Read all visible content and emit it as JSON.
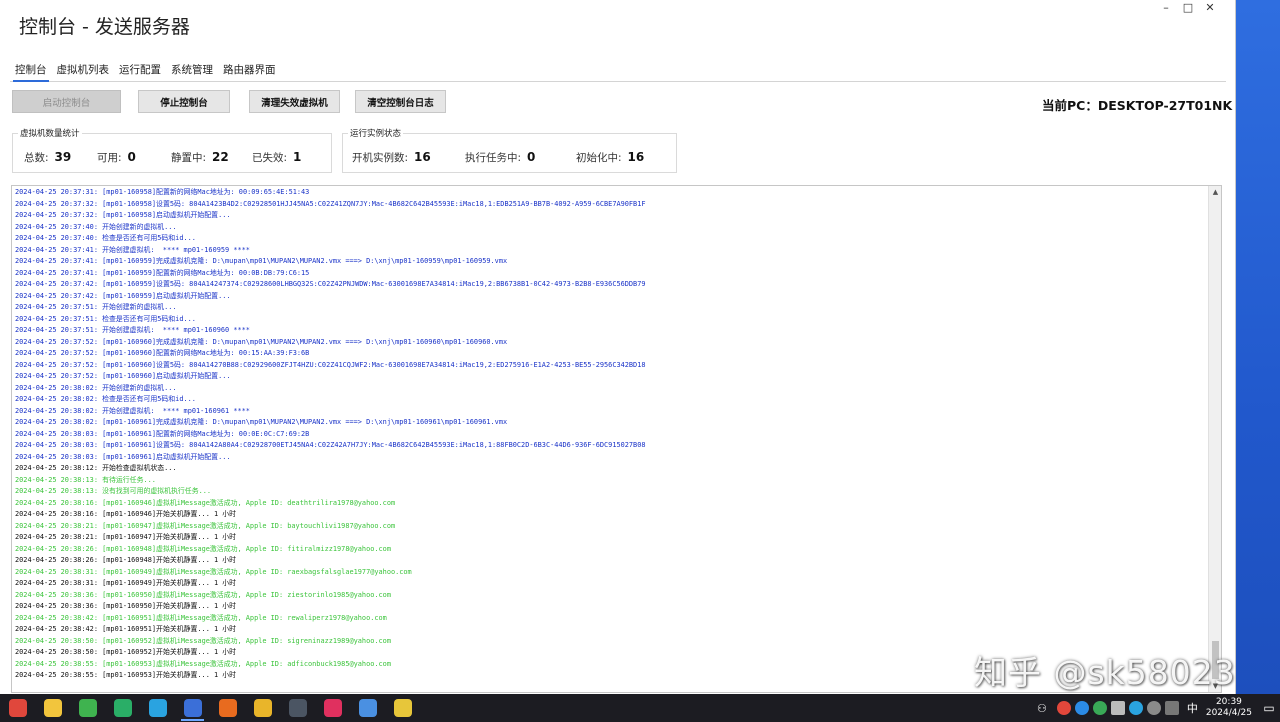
{
  "window": {
    "title": "控制台 - 发送服务器",
    "controls": [
      "–",
      "□",
      "✕"
    ]
  },
  "tabs": [
    "控制台",
    "虚拟机列表",
    "运行配置",
    "系统管理",
    "路由器界面"
  ],
  "buttons": {
    "start": "启动控制台",
    "stop": "停止控制台",
    "clean": "清理失效虚拟机",
    "clear_log": "清空控制台日志"
  },
  "pc": {
    "label": "当前PC：",
    "name": "DESKTOP-27T01NK"
  },
  "vm_stats": {
    "title": "虚拟机数量统计",
    "total_label": "总数:",
    "total": "39",
    "available_label": "可用:",
    "available": "0",
    "idle_label": "静置中:",
    "idle": "22",
    "invalid_label": "已失效:",
    "invalid": "1"
  },
  "run_stats": {
    "title": "运行实例状态",
    "running_label": "开机实例数:",
    "running": "16",
    "tasks_label": "执行任务中:",
    "tasks": "0",
    "init_label": "初始化中:",
    "init": "16"
  },
  "log": [
    {
      "c": "blue",
      "t": "2024-04-25 20:37:31: [mp01-160958]配置新的网络Mac地址为: 00:09:65:4E:51:43"
    },
    {
      "c": "blue",
      "t": "2024-04-25 20:37:32: [mp01-160958]设置5码: 804A1423B4D2:C02928501HJJ45NA5:C02Z41ZQN7JY:Mac-4B682C642B45593E:iMac18,1:EDB251A9-BB7B-4092-A959-6CBE7A90FB1F"
    },
    {
      "c": "blue",
      "t": "2024-04-25 20:37:32: [mp01-160958]启动虚拟机开始配置..."
    },
    {
      "c": "blue",
      "t": "2024-04-25 20:37:40: 开始创建新的虚拟机..."
    },
    {
      "c": "blue",
      "t": "2024-04-25 20:37:40: 检查是否还有可用5码和id..."
    },
    {
      "c": "blue",
      "t": "2024-04-25 20:37:41: 开始创建虚拟机:  **** mp01-160959 ****"
    },
    {
      "c": "blue",
      "t": "2024-04-25 20:37:41: [mp01-160959]完成虚拟机克隆: D:\\mupan\\mp01\\MUPAN2\\MUPAN2.vmx ===> D:\\xnj\\mp01-160959\\mp01-160959.vmx"
    },
    {
      "c": "blue",
      "t": "2024-04-25 20:37:41: [mp01-160959]配置新的网络Mac地址为: 00:0B:DB:79:C6:15"
    },
    {
      "c": "blue",
      "t": "2024-04-25 20:37:42: [mp01-160959]设置5码: 804A14247374:C02928600LHBGQ32S:C02Z42PNJWDW:Mac-63001698E7A34814:iMac19,2:BB6738B1-0C42-4973-B2B8-E936C56DDB79"
    },
    {
      "c": "blue",
      "t": "2024-04-25 20:37:42: [mp01-160959]启动虚拟机开始配置..."
    },
    {
      "c": "blue",
      "t": "2024-04-25 20:37:51: 开始创建新的虚拟机..."
    },
    {
      "c": "blue",
      "t": "2024-04-25 20:37:51: 检查是否还有可用5码和id..."
    },
    {
      "c": "blue",
      "t": "2024-04-25 20:37:51: 开始创建虚拟机:  **** mp01-160960 ****"
    },
    {
      "c": "blue",
      "t": "2024-04-25 20:37:52: [mp01-160960]完成虚拟机克隆: D:\\mupan\\mp01\\MUPAN2\\MUPAN2.vmx ===> D:\\xnj\\mp01-160960\\mp01-160960.vmx"
    },
    {
      "c": "blue",
      "t": "2024-04-25 20:37:52: [mp01-160960]配置新的网络Mac地址为: 00:15:AA:39:F3:6B"
    },
    {
      "c": "blue",
      "t": "2024-04-25 20:37:52: [mp01-160960]设置5码: 804A14270B88:C02929600ZFJT4HZU:C02Z41CQJWF2:Mac-63001698E7A34814:iMac19,2:ED275916-E1A2-4253-BE55-2956C342BD18"
    },
    {
      "c": "blue",
      "t": "2024-04-25 20:37:52: [mp01-160960]启动虚拟机开始配置..."
    },
    {
      "c": "blue",
      "t": "2024-04-25 20:38:02: 开始创建新的虚拟机..."
    },
    {
      "c": "blue",
      "t": "2024-04-25 20:38:02: 检查是否还有可用5码和id..."
    },
    {
      "c": "blue",
      "t": "2024-04-25 20:38:02: 开始创建虚拟机:  **** mp01-160961 ****"
    },
    {
      "c": "blue",
      "t": "2024-04-25 20:38:02: [mp01-160961]完成虚拟机克隆: D:\\mupan\\mp01\\MUPAN2\\MUPAN2.vmx ===> D:\\xnj\\mp01-160961\\mp01-160961.vmx"
    },
    {
      "c": "blue",
      "t": "2024-04-25 20:38:03: [mp01-160961]配置新的网络Mac地址为: 00:0E:0C:C7:69:2B"
    },
    {
      "c": "blue",
      "t": "2024-04-25 20:38:03: [mp01-160961]设置5码: 804A142A80A4:C02928700ETJ45NA4:C02Z42A7H7JY:Mac-4B682C642B45593E:iMac18,1:88FB0C2D-6B3C-44D6-936F-6DC915027B08"
    },
    {
      "c": "blue",
      "t": "2024-04-25 20:38:03: [mp01-160961]启动虚拟机开始配置..."
    },
    {
      "c": "black",
      "t": "2024-04-25 20:38:12: 开始检查虚拟机状态..."
    },
    {
      "c": "green",
      "t": "2024-04-25 20:38:13: 有待运行任务..."
    },
    {
      "c": "green",
      "t": "2024-04-25 20:38:13: 没有找到可用的虚拟机执行任务..."
    },
    {
      "c": "green",
      "t": "2024-04-25 20:38:16: [mp01-160946]虚拟机iMessage激活成功, Apple ID: deathtrilira1978@yahoo.com"
    },
    {
      "c": "black",
      "t": "2024-04-25 20:38:16: [mp01-160946]开始关机静置... 1 小时"
    },
    {
      "c": "green",
      "t": "2024-04-25 20:38:21: [mp01-160947]虚拟机iMessage激活成功, Apple ID: baytouchlivi1987@yahoo.com"
    },
    {
      "c": "black",
      "t": "2024-04-25 20:38:21: [mp01-160947]开始关机静置... 1 小时"
    },
    {
      "c": "green",
      "t": "2024-04-25 20:38:26: [mp01-160948]虚拟机iMessage激活成功, Apple ID: fitiralmizz1978@yahoo.com"
    },
    {
      "c": "black",
      "t": "2024-04-25 20:38:26: [mp01-160948]开始关机静置... 1 小时"
    },
    {
      "c": "green",
      "t": "2024-04-25 20:38:31: [mp01-160949]虚拟机iMessage激活成功, Apple ID: raexbagsfalsglae1977@yahoo.com"
    },
    {
      "c": "black",
      "t": "2024-04-25 20:38:31: [mp01-160949]开始关机静置... 1 小时"
    },
    {
      "c": "green",
      "t": "2024-04-25 20:38:36: [mp01-160950]虚拟机iMessage激活成功, Apple ID: ziestorinlo1985@yahoo.com"
    },
    {
      "c": "black",
      "t": "2024-04-25 20:38:36: [mp01-160950]开始关机静置... 1 小时"
    },
    {
      "c": "green",
      "t": "2024-04-25 20:38:42: [mp01-160951]虚拟机iMessage激活成功, Apple ID: rewaliperz1978@yahoo.com"
    },
    {
      "c": "black",
      "t": "2024-04-25 20:38:42: [mp01-160951]开始关机静置... 1 小时"
    },
    {
      "c": "green",
      "t": "2024-04-25 20:38:50: [mp01-160952]虚拟机iMessage激活成功, Apple ID: sigreninazz1989@yahoo.com"
    },
    {
      "c": "black",
      "t": "2024-04-25 20:38:50: [mp01-160952]开始关机静置... 1 小时"
    },
    {
      "c": "green",
      "t": "2024-04-25 20:38:55: [mp01-160953]虚拟机iMessage激活成功, Apple ID: adficonbuck1985@yahoo.com"
    },
    {
      "c": "black",
      "t": "2024-04-25 20:38:55: [mp01-160953]开始关机静置... 1 小时"
    }
  ],
  "watermark": "知乎 @sk58023",
  "taskbar": {
    "apps": [
      {
        "name": "app-red-icon",
        "color": "#e0473c"
      },
      {
        "name": "file-explorer-icon",
        "color": "#f2c53d"
      },
      {
        "name": "refresh-app-icon",
        "color": "#3fb34f"
      },
      {
        "name": "wechat-icon",
        "color": "#2aae67"
      },
      {
        "name": "telegram-icon",
        "color": "#2aa3e0"
      },
      {
        "name": "remote-desktop-icon",
        "color": "#3b6fd8"
      },
      {
        "name": "vpn-icon",
        "color": "#e86b1f"
      },
      {
        "name": "chrome-icon",
        "color": "#e9b52a"
      },
      {
        "name": "console-app-icon",
        "color": "#4b5563"
      },
      {
        "name": "pink-app-icon",
        "color": "#e0305f"
      },
      {
        "name": "browser-icon",
        "color": "#4a90e2"
      },
      {
        "name": "yellow-app-icon",
        "color": "#e7c63a"
      }
    ],
    "time": "20:39",
    "date": "2024/4/25",
    "ime": "中"
  }
}
